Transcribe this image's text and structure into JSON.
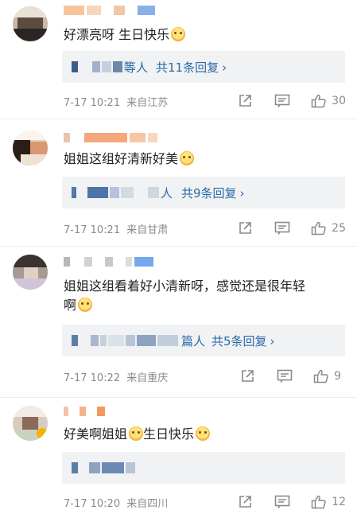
{
  "comments": [
    {
      "text": "好漂亮呀 生日快乐",
      "reply_prefix": "等人",
      "reply_count": "共11条回复",
      "time": "7-17 10:21",
      "location": "来自江苏",
      "likes": "30"
    },
    {
      "text": "姐姐这组好清新好美",
      "reply_prefix": "人",
      "reply_count": "共9条回复",
      "time": "7-17 10:21",
      "location": "来自甘肃",
      "likes": "25"
    },
    {
      "text": "姐姐这组看着好小清新呀，感觉还是很年轻",
      "text_line2": "啊",
      "reply_prefix": "篇人",
      "reply_count": "共5条回复",
      "time": "7-17 10:22",
      "location": "来自重庆",
      "likes": "9"
    },
    {
      "text": "好美啊姐姐",
      "text_tail": "生日快乐",
      "time": "7-17 10:20",
      "location": "来自四川",
      "likes": "12"
    }
  ],
  "icons": {
    "share": "share-icon",
    "comment": "comment-icon",
    "like": "thumbs-up-icon",
    "reply_chevron": "chevron-right-icon",
    "emoji": "emoji-icon"
  },
  "colors": {
    "link": "#2a6aa7",
    "meta": "#8a8a8a",
    "reply_bg": "#f1f2f4"
  }
}
